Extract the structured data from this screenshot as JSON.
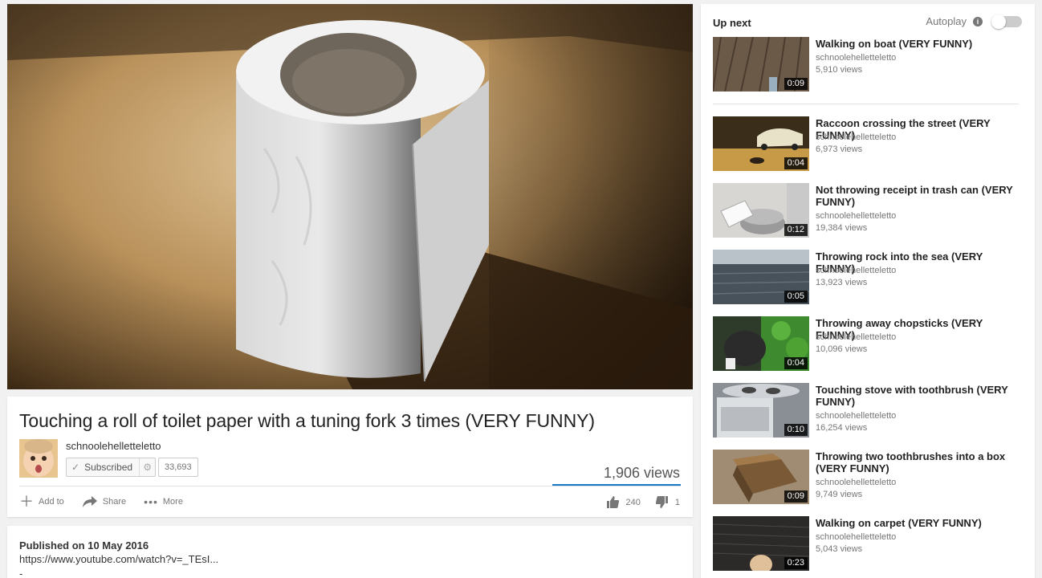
{
  "video": {
    "title": "Touching a roll of toilet paper with a tuning fork 3 times (VERY FUNNY)",
    "channel": "schnoolehelletteletto",
    "subscribe_label": "Subscribed",
    "subscriber_count": "33,693",
    "views": "1,906 views",
    "like_count": "240",
    "dislike_count": "1",
    "actions": {
      "add_to": "Add to",
      "share": "Share",
      "more": "More"
    }
  },
  "description": {
    "published": "Published on 10 May 2016",
    "url": "https://www.youtube.com/watch?v=_TEsI...",
    "extra": "-"
  },
  "sidebar": {
    "up_next": "Up next",
    "autoplay": "Autoplay",
    "autoplay_on": false,
    "videos": [
      {
        "title": "Walking on boat (VERY FUNNY)",
        "channel": "schnoolehelletteletto",
        "views": "5,910 views",
        "duration": "0:09"
      },
      {
        "title": "Raccoon crossing the street (VERY FUNNY)",
        "channel": "schnoolehelletteletto",
        "views": "6,973 views",
        "duration": "0:04"
      },
      {
        "title": "Not throwing receipt in trash can (VERY FUNNY)",
        "channel": "schnoolehelletteletto",
        "views": "19,384 views",
        "duration": "0:12"
      },
      {
        "title": "Throwing rock into the sea (VERY FUNNY)",
        "channel": "schnoolehelletteletto",
        "views": "13,923 views",
        "duration": "0:05"
      },
      {
        "title": "Throwing away chopsticks (VERY FUNNY)",
        "channel": "schnoolehelletteletto",
        "views": "10,096 views",
        "duration": "0:04"
      },
      {
        "title": "Touching stove with toothbrush (VERY FUNNY)",
        "channel": "schnoolehelletteletto",
        "views": "16,254 views",
        "duration": "0:10"
      },
      {
        "title": "Throwing two toothbrushes into a box (VERY FUNNY)",
        "channel": "schnoolehelletteletto",
        "views": "9,749 views",
        "duration": "0:09"
      },
      {
        "title": "Walking on carpet (VERY FUNNY)",
        "channel": "schnoolehelletteletto",
        "views": "5,043 views",
        "duration": "0:23"
      }
    ]
  },
  "colors": {
    "accent_blue": "#167ac6",
    "background": "#f1f1f1"
  }
}
